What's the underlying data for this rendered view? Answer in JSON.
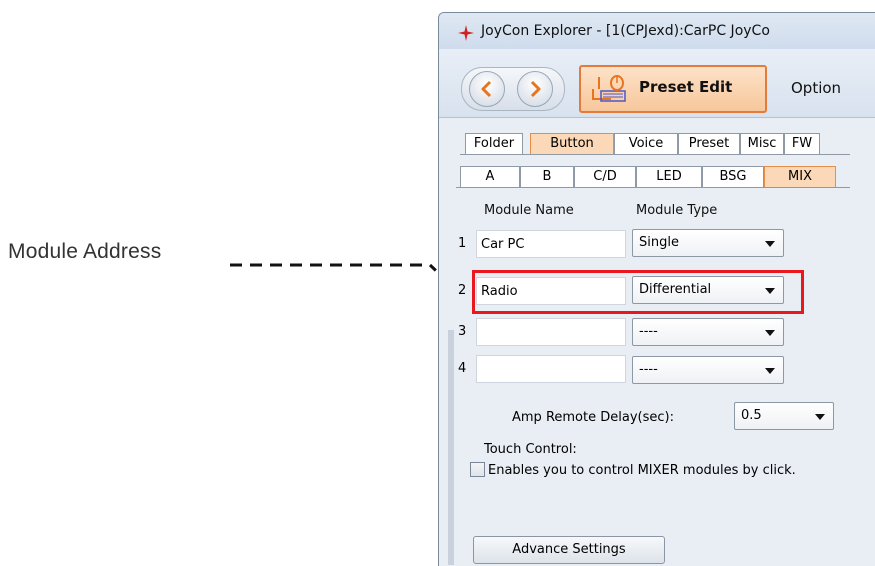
{
  "annotation": {
    "label": "Module Address"
  },
  "window": {
    "title": "JoyCon Explorer - [1(CPJexd):CarPC JoyCo"
  },
  "toolbar": {
    "preset_edit_label": "Preset Edit",
    "option_label": "Option"
  },
  "tabs_top": [
    "Folder",
    "Button",
    "Voice",
    "Preset",
    "Misc",
    "FW"
  ],
  "tabs_top_active": "Button",
  "tabs_sub": [
    "A",
    "B",
    "C/D",
    "LED",
    "BSG",
    "MIX"
  ],
  "tabs_sub_active": "MIX",
  "columns": {
    "module_name": "Module Name",
    "module_type": "Module Type"
  },
  "modules": [
    {
      "num": "1",
      "name": "Car PC",
      "type": "Single"
    },
    {
      "num": "2",
      "name": "Radio",
      "type": "Differential"
    },
    {
      "num": "3",
      "name": "",
      "type": "----"
    },
    {
      "num": "4",
      "name": "",
      "type": "----"
    }
  ],
  "amp": {
    "label": "Amp Remote Delay(sec):",
    "value": "0.5"
  },
  "touch": {
    "title": "Touch Control:",
    "description": "Enables you to control MIXER modules by click.",
    "checked": false
  },
  "advance_button": "Advance Settings",
  "colors": {
    "highlight": "#e8181e",
    "active_tab": "#fbd8b8",
    "accent": "#e57b3a"
  }
}
